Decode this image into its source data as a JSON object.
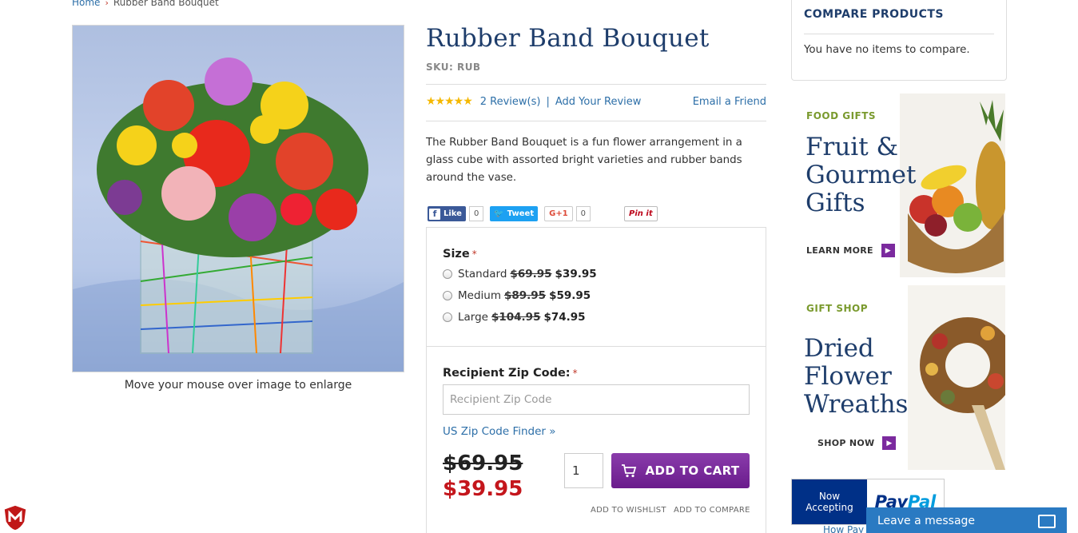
{
  "breadcrumb": {
    "home": "Home",
    "sep": "›",
    "current": "Rubber Band Bouquet"
  },
  "product": {
    "image_caption": "Move your mouse over image to enlarge",
    "title": "Rubber Band Bouquet",
    "sku": "SKU: RUB",
    "stars": "★★★★★",
    "reviews_link": "2 Review(s)",
    "reviews_sep": "|",
    "add_review": "Add Your Review",
    "email_friend": "Email a Friend",
    "description": "The Rubber Band Bouquet is a fun flower arrangement in a glass cube with assorted bright varieties and rubber bands around the vase."
  },
  "social": {
    "like": "Like",
    "like_count": "0",
    "tweet": "Tweet",
    "gplus": "G+1",
    "gplus_count": "0",
    "pin": "Pin it"
  },
  "options": {
    "size_label": "Size",
    "required": "*",
    "sizes": [
      {
        "name": "Standard",
        "old": "$69.95",
        "new": "$39.95"
      },
      {
        "name": "Medium",
        "old": "$89.95",
        "new": "$59.95"
      },
      {
        "name": "Large",
        "old": "$104.95",
        "new": "$74.95"
      }
    ],
    "zip_label": "Recipient Zip Code:",
    "zip_placeholder": "Recipient Zip Code",
    "zip_finder": "US Zip Code Finder »",
    "old_price": "$69.95",
    "new_price": "$39.95",
    "qty": "1",
    "add_to_cart": "ADD TO CART",
    "wishlist": "ADD TO WISHLIST",
    "compare": "ADD TO COMPARE"
  },
  "compare": {
    "title": "COMPARE PRODUCTS",
    "empty": "You have no items to compare."
  },
  "banners": [
    {
      "kicker": "FOOD GIFTS",
      "lines": [
        "Fruit &",
        "Gourmet",
        "Gifts"
      ],
      "cta": "LEARN MORE"
    },
    {
      "kicker": "GIFT SHOP",
      "lines": [
        "Dried",
        "Flower",
        "Wreaths"
      ],
      "cta": "SHOP NOW"
    }
  ],
  "paypal": {
    "now": "Now",
    "accepting": "Accepting",
    "pay": "Pay",
    "pal": "Pal",
    "how": "How Pay"
  },
  "chat": {
    "label": "Leave a message"
  },
  "colors": {
    "navy": "#1e3d6b",
    "purple": "#6a1c8c",
    "sale_red": "#c4161c",
    "link": "#2d6fa8",
    "kicker_green": "#7a9a2e"
  }
}
